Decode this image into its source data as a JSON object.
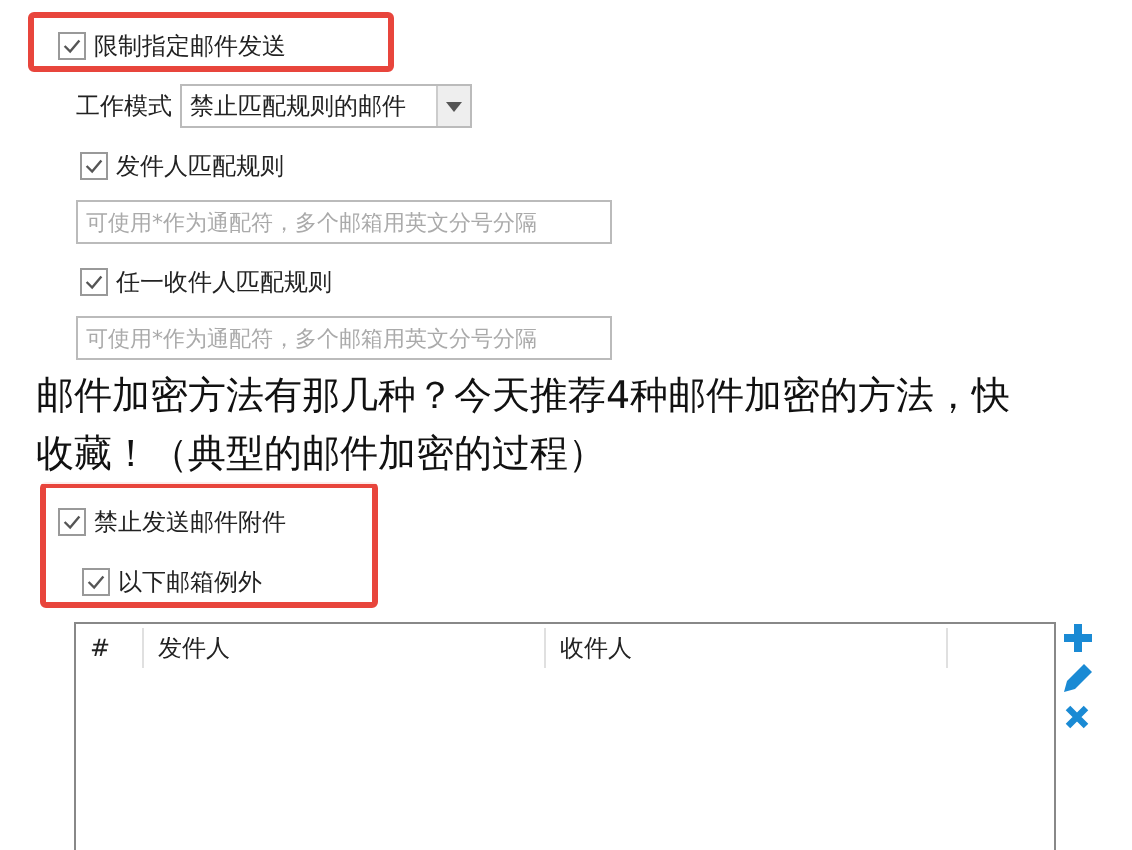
{
  "restrict": {
    "label": "限制指定邮件发送",
    "checked": true
  },
  "mode": {
    "label": "工作模式",
    "value": "禁止匹配规则的邮件"
  },
  "sender_rule": {
    "label": "发件人匹配规则",
    "checked": true,
    "placeholder": "可使用*作为通配符，多个邮箱用英文分号分隔"
  },
  "recipient_rule": {
    "label": "任一收件人匹配规则",
    "checked": true,
    "placeholder": "可使用*作为通配符，多个邮箱用英文分号分隔"
  },
  "caption": "邮件加密方法有那几种？今天推荐4种邮件加密的方法，快收藏！（典型的邮件加密的过程）",
  "block_attachments": {
    "label": "禁止发送邮件附件",
    "checked": true
  },
  "exceptions": {
    "label": "以下邮箱例外",
    "checked": true
  },
  "table": {
    "columns": [
      "#",
      "发件人",
      "收件人"
    ]
  }
}
